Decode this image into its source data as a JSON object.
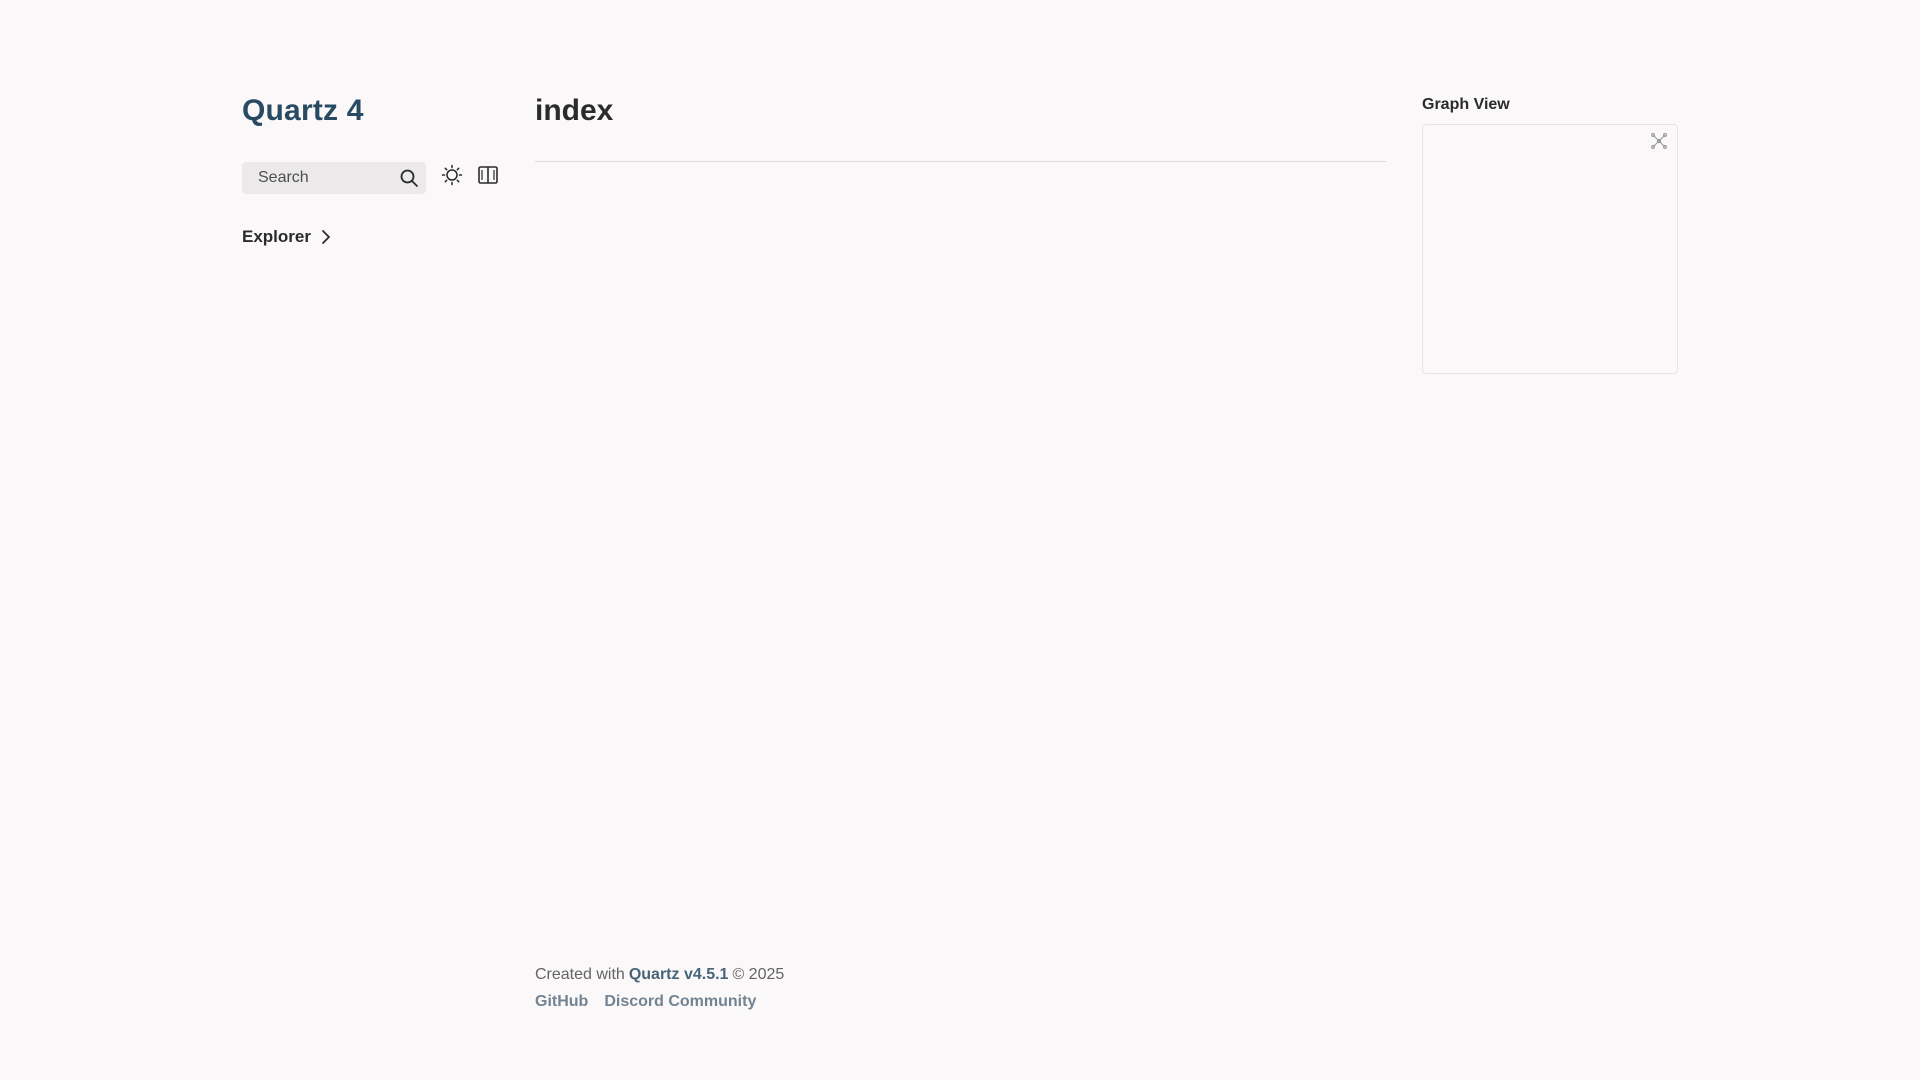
{
  "sidebar": {
    "site_title": "Quartz 4",
    "search": {
      "label": "Search",
      "icon": "search-icon"
    },
    "darkmode_icon": "sun-icon",
    "readermode_icon": "book-icon",
    "explorer": {
      "label": "Explorer",
      "icon": "chevron-right-icon"
    }
  },
  "article": {
    "title": "index"
  },
  "graph": {
    "heading": "Graph View",
    "global_icon": "global-graph-icon"
  },
  "footer": {
    "created_prefix": "Created with",
    "quartz_link": "Quartz v4.5.1",
    "copyright": "© 2025",
    "links": [
      {
        "label": "GitHub"
      },
      {
        "label": "Discord Community"
      }
    ]
  },
  "colors": {
    "background": "#faf8f8",
    "accent": "#284b63",
    "text": "#2b2b2b",
    "muted": "#646464",
    "search_bg": "#ebe9ea"
  }
}
